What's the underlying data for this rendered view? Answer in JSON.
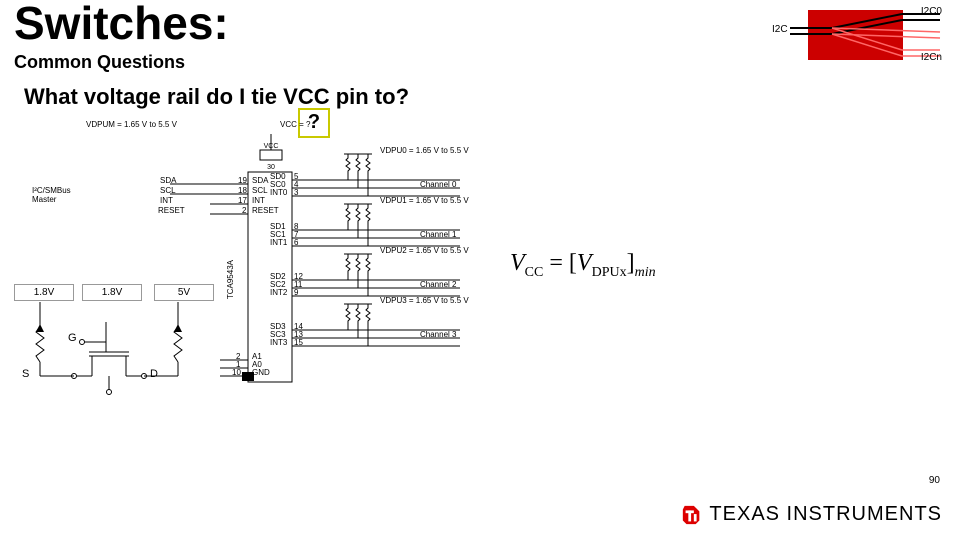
{
  "title": "Switches:",
  "subtitle": "Common Questions",
  "question": "What voltage rail do I tie VCC pin to?",
  "qmark": "?",
  "equation": {
    "lhs_sym": "V",
    "lhs_sub": "CC",
    "eq": " = ",
    "rhs_open": "[",
    "rhs_sym": "V",
    "rhs_sub": "DPUx",
    "rhs_close": "]",
    "rhs_min": "min"
  },
  "icon": {
    "left": "I2C",
    "top_right": "I2C0",
    "bottom_right": "I2Cn"
  },
  "mosfet": {
    "left_rail": "1.8V",
    "gate_rail": "1.8V",
    "right_rail": "5V",
    "g": "G",
    "s": "S",
    "d": "D"
  },
  "ic": {
    "vdpum": "VDPUM = 1.65 V to 5.5 V",
    "vcc_lbl": "VCC = ?",
    "master": "I²C/SMBus Master",
    "pins_left": [
      "SDA",
      "SCL",
      "INT",
      "RESET"
    ],
    "part": "TCA9543A",
    "center_top": [
      "SDA",
      "SCL",
      "INT",
      "RESET",
      "VCC"
    ],
    "center_top_nums": [
      "19",
      "18",
      "17",
      "2",
      "30"
    ],
    "bus": [
      {
        "sd": "SD0",
        "sc": "SC0",
        "int": "INT0",
        "n": [
          "5",
          "4",
          "3"
        ],
        "v": "VDPU0 = 1.65 V to 5.5 V",
        "ch": "Channel 0"
      },
      {
        "sd": "SD1",
        "sc": "SC1",
        "int": "INT1",
        "n": [
          "8",
          "7",
          "6"
        ],
        "v": "VDPU1 = 1.65 V to 5.5 V",
        "ch": "Channel 1"
      },
      {
        "sd": "SD2",
        "sc": "SC2",
        "int": "INT2",
        "n": [
          "12",
          "11",
          "9"
        ],
        "v": "VDPU2 = 1.65 V to 5.5 V",
        "ch": "Channel 2"
      },
      {
        "sd": "SD3",
        "sc": "SC3",
        "int": "INT3",
        "n": [
          "14",
          "13",
          "15"
        ],
        "v": "VDPU3 = 1.65 V to 5.5 V",
        "ch": "Channel 3"
      }
    ],
    "addr": [
      "A1",
      "A0",
      "GND"
    ],
    "addr_nums": [
      "2",
      "1",
      "10"
    ]
  },
  "footer": {
    "page": "90",
    "brand": "TEXAS INSTRUMENTS"
  }
}
